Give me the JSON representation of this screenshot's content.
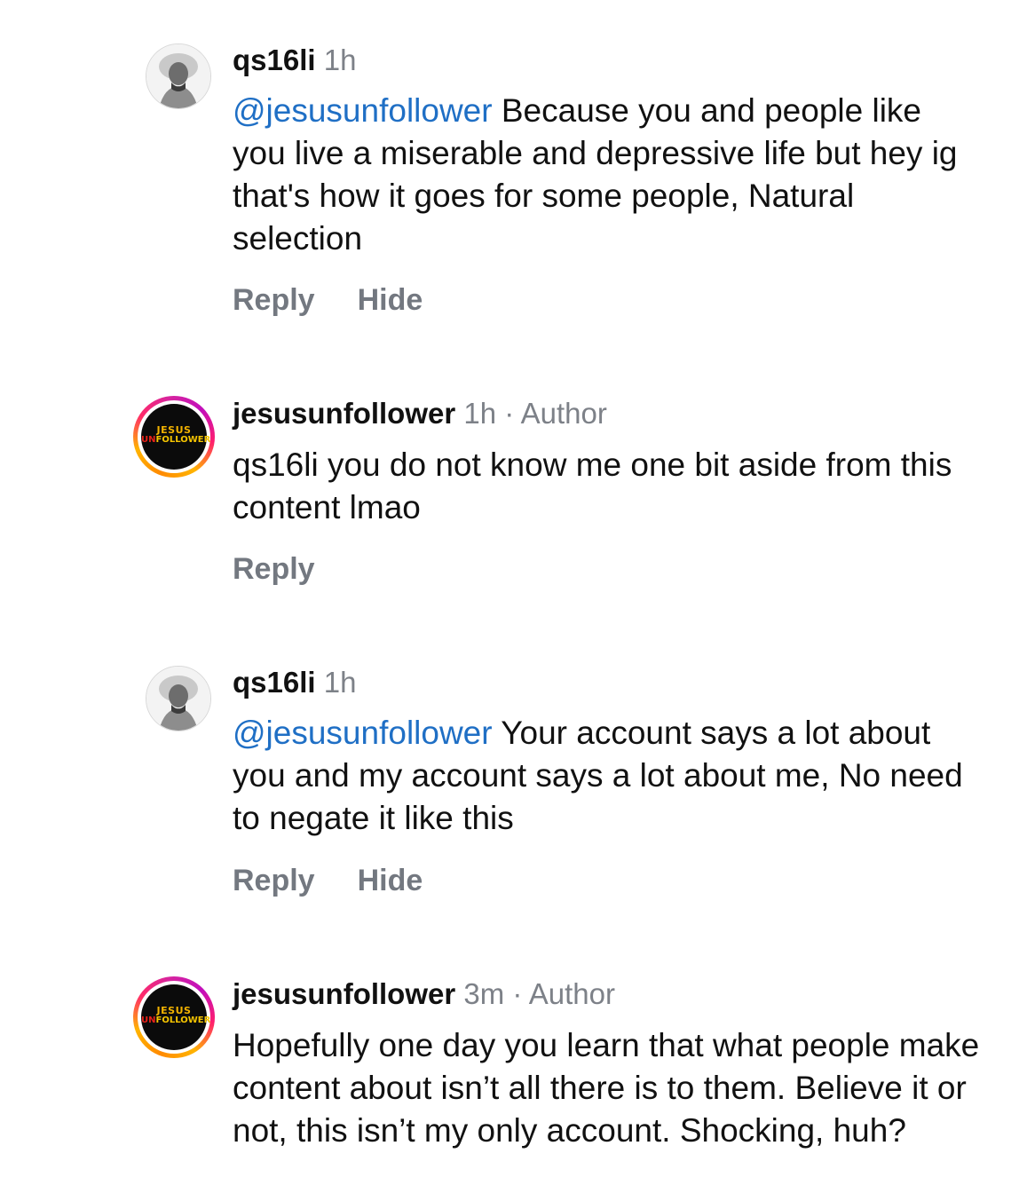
{
  "comments": [
    {
      "username": "qs16li",
      "time": "1h",
      "author_tag": "",
      "mention": "@jesusunfollower",
      "text": "Because you and people like you live a miserable and depressive life but hey ig that's how it goes for some people, Natural selection",
      "actions": [
        "Reply",
        "Hide"
      ],
      "avatar_icon": "profile-photo-icon"
    },
    {
      "username": "jesusunfollower",
      "time": "1h",
      "author_tag": "Author",
      "mention": "",
      "text": "qs16li you do not know me one bit aside from this content lmao",
      "actions": [
        "Reply"
      ],
      "avatar_logo": {
        "line1": "JESUS",
        "line2_a": "UN",
        "line2_b": "FOLLOWER"
      }
    },
    {
      "username": "qs16li",
      "time": "1h",
      "author_tag": "",
      "mention": "@jesusunfollower",
      "text": "Your account says a lot about you and my account says a lot about me, No need to negate it like this",
      "actions": [
        "Reply",
        "Hide"
      ],
      "avatar_icon": "profile-photo-icon"
    },
    {
      "username": "jesusunfollower",
      "time": "3m",
      "author_tag": "Author",
      "mention": "",
      "text": "Hopefully one day you learn that what people make content about isn’t all there is to them. Believe it or not, this isn’t my only account. Shocking, huh?",
      "actions": [],
      "avatar_logo": {
        "line1": "JESUS",
        "line2_a": "UN",
        "line2_b": "FOLLOWER"
      }
    }
  ],
  "separator": " · ",
  "colors": {
    "mention": "#1f6fc5",
    "meta": "#7d8188",
    "action": "#737880",
    "text": "#111111"
  }
}
